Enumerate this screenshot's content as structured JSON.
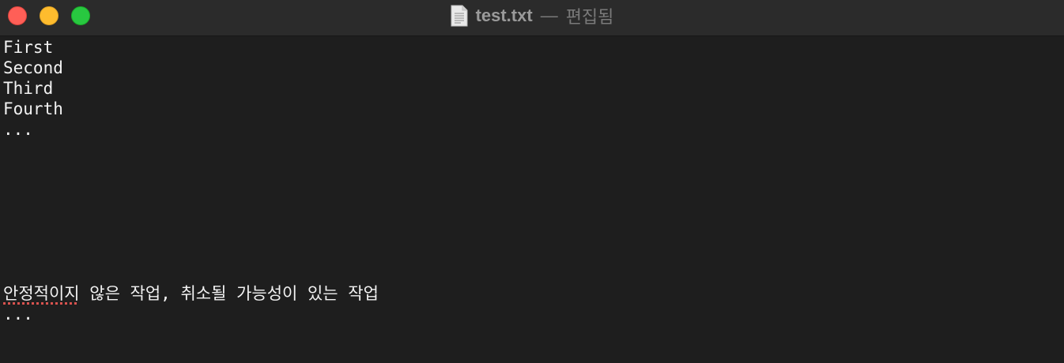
{
  "window": {
    "file_name": "test.txt",
    "separator": "—",
    "status": "편집됨"
  },
  "editor": {
    "lines": [
      "First",
      "Second",
      "Third",
      "Fourth",
      "...",
      "",
      "..."
    ],
    "line6_misspelled": "안정적이지",
    "line6_rest": " 않은 작업, 취소될 가능성이 있는 작업"
  }
}
